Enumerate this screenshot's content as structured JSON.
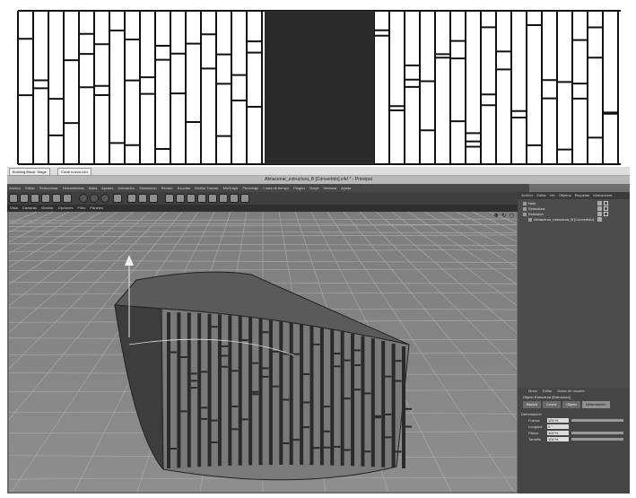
{
  "app": {
    "tabs": [
      "Building Block: Stage",
      "Crear nuevo.c4d"
    ],
    "title": "Almacenar_estructura_B [Convertido].c4d * - Principal",
    "menu": [
      "Archivo",
      "Editar",
      "Seleccionar",
      "Herramientas",
      "Malla",
      "Ajustes",
      "Animación",
      "Simulación",
      "Render",
      "Escultar",
      "Motion Tracker",
      "MoGraph",
      "Personaje",
      "Línea de tiempo",
      "Plugins",
      "Script",
      "Ventana",
      "Ayuda"
    ],
    "view_menu": [
      "Vista",
      "Cámaras",
      "Mostrar",
      "Opciones",
      "Filtro",
      "Paneles"
    ],
    "viewport_icons": "✥ ↻ ◻",
    "object_manager": {
      "menu": [
        "Archivo",
        "Editar",
        "Ver",
        "Objetos",
        "Etiquetas",
        "Marcadores"
      ],
      "items": [
        {
          "label": "Nulo"
        },
        {
          "label": "Estructura"
        },
        {
          "label": "Extrusión"
        },
        {
          "label": "Almacenar_estructura_B [Convertido]"
        }
      ]
    },
    "attributes": {
      "menu": [
        "Modo",
        "Editar",
        "Datos de usuario"
      ],
      "title": "Objeto Estructura [Estructura]",
      "tabs": [
        "Básico",
        "Coord.",
        "Objeto",
        "Deformación"
      ],
      "active_tab": "Deformación",
      "section": "Deformación",
      "rows": [
        {
          "label": "Fuerza",
          "value": "100 %"
        },
        {
          "label": "Longitud",
          "value": "0 °"
        },
        {
          "label": "Pasos",
          "value": "100 %"
        },
        {
          "label": "Tamaño",
          "value": "100 %"
        }
      ]
    }
  },
  "colors": {
    "pattern_fill": "#2b2b2b",
    "app_bg": "#6e6e6e",
    "viewport_bg": "#858585",
    "shape_top": "#5a5a5a",
    "shape_side": "#3d3d3d"
  }
}
